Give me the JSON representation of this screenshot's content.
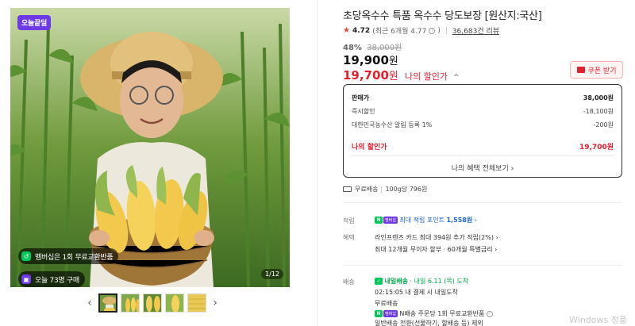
{
  "gallery": {
    "today_tag": "오늘끝딜",
    "pill_exchange": "멤버십은 1회 무료교환반품",
    "pill_buyers": "오늘 73명 구매",
    "pager": "1/12",
    "prev_arrow": "‹",
    "next_arrow": "›"
  },
  "product": {
    "title": "초당옥수수 특품 옥수수 당도보장 [원산지:국산]",
    "rating_star": "★",
    "rating": "4.72",
    "rating_sub": "(최근 6개월 4.77",
    "rating_sub_end": ")",
    "reviews": "36,683건 리뷰",
    "discount_pct": "48%",
    "original_price": "38,000원",
    "sale_price": "19,900",
    "won": "원",
    "my_price": "19,700",
    "my_price_label": "나의 할인가",
    "my_price_caret": "^",
    "coupon_button": "쿠폰 받기"
  },
  "price_box": {
    "rows": [
      {
        "label": "판매가",
        "value": "38,000원"
      },
      {
        "label": "즉시할인",
        "value": "-18,100원"
      },
      {
        "label": "대한민국농수산 알림 등록 1%",
        "value": "-200원"
      }
    ],
    "mine_label": "나의 할인가",
    "mine_value": "19,700원",
    "see_all": "나의 혜택 전체보기 ›"
  },
  "shipping_summary": {
    "free": "무료배송",
    "unit_price": "100g당 796원"
  },
  "points": {
    "label": "적립",
    "npay": "N",
    "membership": "멤버십",
    "text": "최대 적립 포인트",
    "amount": "1,558원",
    "arrow": "›"
  },
  "benefits": {
    "label": "혜택",
    "line1": "라인프렌즈 카드 최대 394원 추가 적립(2%)",
    "line1_arrow": "›",
    "line2": "최대 12개월 무이자 할부 · 60개월 특별금리",
    "line2_arrow": "›"
  },
  "delivery": {
    "label": "배송",
    "badge": "내일배송",
    "arrival": "· 내일 6.11 (목) 도착",
    "deadline": "02:15:05  내 결제 시 내일도착",
    "fee": "무료배송",
    "return_text": "N배송 주문당 1회 무료교환반품",
    "fine_print": "일반배송 전환(선물하기, 할배송 등) 제외"
  },
  "os": {
    "watermark": "Windows 정품"
  },
  "colors": {
    "accent_red": "#e5202e",
    "naver_green": "#03c75a",
    "membership_purple": "#6e3ae6",
    "link_blue": "#1a64d8"
  }
}
